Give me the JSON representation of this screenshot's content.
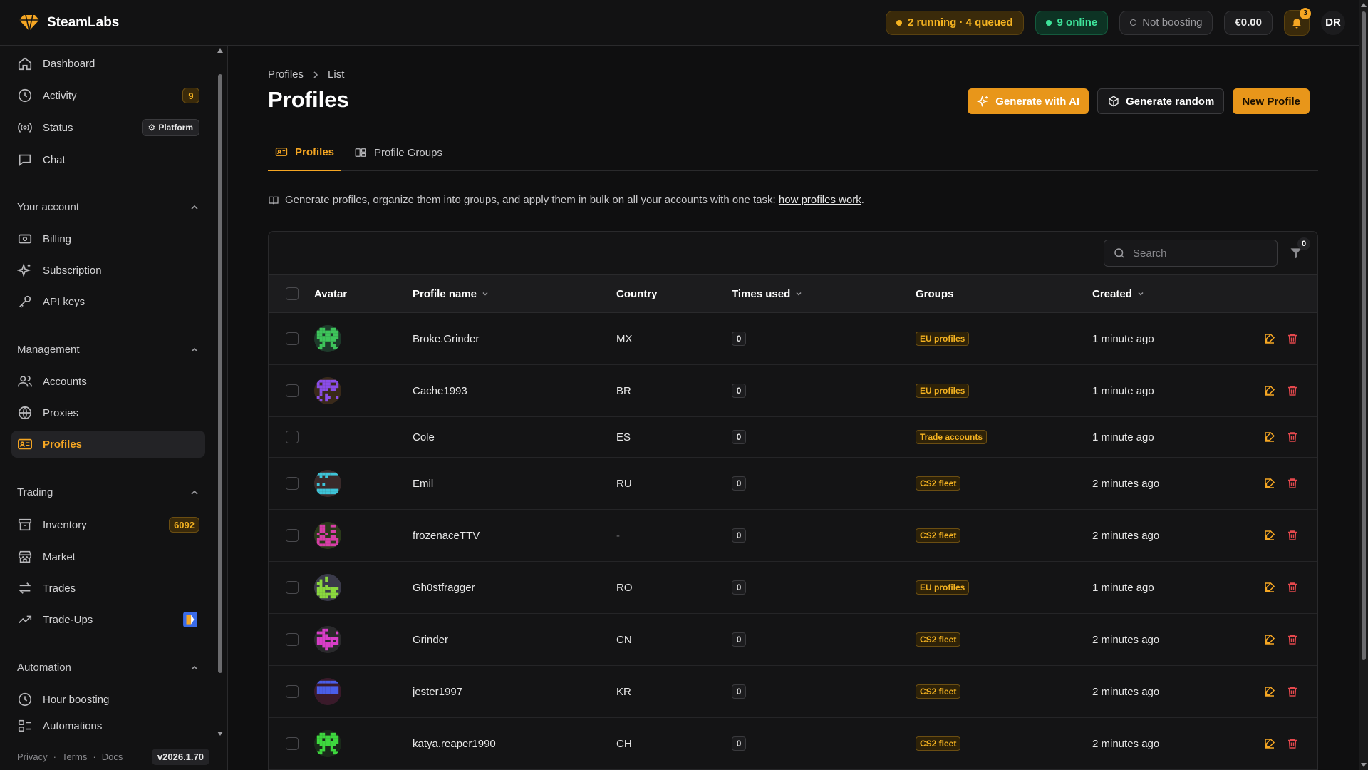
{
  "app": {
    "name": "SteamLabs",
    "colors": {
      "accent": "#f5a623",
      "danger": "#e5484d",
      "success": "#3ee29a"
    }
  },
  "topbar": {
    "queue_status": "2 running · 4 queued",
    "online_status": "9 online",
    "boost_status": "Not boosting",
    "balance": "€0.00",
    "notifications_count": "3",
    "user_initials": "DR"
  },
  "sidebar": {
    "top_items": [
      {
        "label": "Dashboard",
        "icon": "home-icon"
      },
      {
        "label": "Activity",
        "icon": "clock-icon",
        "badge": "9"
      },
      {
        "label": "Status",
        "icon": "broadcast-icon",
        "tag": "Platform"
      },
      {
        "label": "Chat",
        "icon": "chat-icon"
      }
    ],
    "sections": [
      {
        "title": "Your account",
        "items": [
          {
            "label": "Billing",
            "icon": "billing-icon"
          },
          {
            "label": "Subscription",
            "icon": "sparkles-icon"
          },
          {
            "label": "API keys",
            "icon": "key-icon"
          }
        ]
      },
      {
        "title": "Management",
        "items": [
          {
            "label": "Accounts",
            "icon": "users-icon"
          },
          {
            "label": "Proxies",
            "icon": "globe-icon"
          },
          {
            "label": "Profiles",
            "icon": "id-card-icon"
          }
        ]
      },
      {
        "title": "Trading",
        "items": [
          {
            "label": "Inventory",
            "icon": "archive-icon",
            "badge": "6092"
          },
          {
            "label": "Market",
            "icon": "store-icon"
          },
          {
            "label": "Trades",
            "icon": "arrows-icon"
          },
          {
            "label": "Trade-Ups",
            "icon": "trending-up-icon"
          }
        ]
      },
      {
        "title": "Automation",
        "items": [
          {
            "label": "Hour boosting",
            "icon": "clock-icon"
          },
          {
            "label": "Automations",
            "icon": "workflow-icon"
          }
        ]
      }
    ],
    "footer": {
      "privacy": "Privacy",
      "terms": "Terms",
      "docs": "Docs",
      "version": "v2026.1.70",
      "sep": "·"
    }
  },
  "main": {
    "breadcrumb": [
      "Profiles",
      "List"
    ],
    "title": "Profiles",
    "actions": {
      "generate_ai": "Generate with AI",
      "generate_random": "Generate random",
      "new_profile": "New Profile"
    },
    "tabs": [
      {
        "label": "Profiles"
      },
      {
        "label": "Profile Groups"
      }
    ],
    "info_text": "Generate profiles, organize them into groups, and apply them in bulk on all your accounts with one task:",
    "info_link": "how profiles work",
    "info_end": ".",
    "search_placeholder": "Search",
    "filter_count": "0",
    "columns": {
      "avatar": "Avatar",
      "name": "Profile name",
      "country": "Country",
      "times_used": "Times used",
      "groups": "Groups",
      "created": "Created"
    },
    "rows": [
      {
        "name": "Broke.Grinder",
        "country": "MX",
        "times_used": "0",
        "group": "EU profiles",
        "created": "1 minute ago",
        "avatar_color": "#3ec45a",
        "avatar_bg": "#1d3a2a"
      },
      {
        "name": "Cache1993",
        "country": "BR",
        "times_used": "0",
        "group": "EU profiles",
        "created": "1 minute ago",
        "avatar_color": "#8a4de8",
        "avatar_bg": "#3a2a1a"
      },
      {
        "name": "Cole",
        "country": "ES",
        "times_used": "0",
        "group": "Trade accounts",
        "created": "1 minute ago",
        "avatar_color": "",
        "avatar_bg": ""
      },
      {
        "name": "Emil",
        "country": "RU",
        "times_used": "0",
        "group": "CS2 fleet",
        "created": "2 minutes ago",
        "avatar_color": "#3ec4d8",
        "avatar_bg": "#3a2a2a"
      },
      {
        "name": "frozenaceTTV",
        "country": "-",
        "times_used": "0",
        "group": "CS2 fleet",
        "created": "2 minutes ago",
        "avatar_color": "#d83ea8",
        "avatar_bg": "#2a3a1a"
      },
      {
        "name": "Gh0stfragger",
        "country": "RO",
        "times_used": "0",
        "group": "EU profiles",
        "created": "1 minute ago",
        "avatar_color": "#8ad83e",
        "avatar_bg": "#3a3a4a"
      },
      {
        "name": "Grinder",
        "country": "CN",
        "times_used": "0",
        "group": "CS2 fleet",
        "created": "2 minutes ago",
        "avatar_color": "#d83ec8",
        "avatar_bg": "#2a2a2c"
      },
      {
        "name": "jester1997",
        "country": "KR",
        "times_used": "0",
        "group": "CS2 fleet",
        "created": "2 minutes ago",
        "avatar_color": "#4a5ee8",
        "avatar_bg": "#3a1a2a"
      },
      {
        "name": "katya.reaper1990",
        "country": "CH",
        "times_used": "0",
        "group": "CS2 fleet",
        "created": "2 minutes ago",
        "avatar_color": "#3ed83e",
        "avatar_bg": "#1a2a1a"
      }
    ]
  }
}
